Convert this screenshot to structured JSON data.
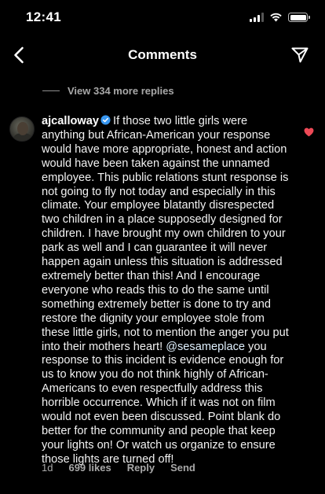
{
  "status_bar": {
    "time": "12:41",
    "icons": [
      "cellular-signal-icon",
      "wifi-icon",
      "battery-icon"
    ]
  },
  "header": {
    "title": "Comments",
    "back_icon": "chevron-left-icon",
    "share_icon": "paper-plane-icon"
  },
  "replies_link": "View 334 more replies",
  "comment": {
    "username": "ajcalloway",
    "verified": true,
    "text_before_mention": "If those two little girls were anything but African-American your response would have more appropriate, honest and action would have been taken against the unnamed employee. This public relations stunt response is not going to fly not today and especially in this climate. Your employee blatantly disrespected two children in a place supposedly designed for children. I have brought my own children to your park as well and I can guarantee it will never happen again unless this situation is addressed extremely better than this!  And I encourage everyone who reads this to do the same until something extremely better is done to try and restore the dignity your employee stole from these little girls, not to mention the anger you put into their mothers heart! ",
    "mention": "@sesameplace",
    "text_after_mention": " you response to this incident is evidence enough for us to know you do not think highly of African-Americans to even respectfully address this horrible occurrence. Which if it was not on film would not even been discussed. Point blank do better for the community and people that keep your lights on!  Or watch us organize to ensure those lights are turned off!",
    "liked": true,
    "like_color": "#ed4956",
    "age": "1d",
    "likes": "699 likes",
    "reply_label": "Reply",
    "send_label": "Send"
  }
}
